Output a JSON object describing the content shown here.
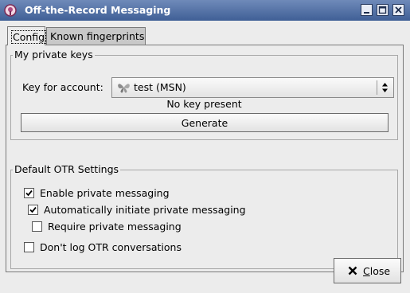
{
  "window": {
    "title": "Off-the-Record Messaging"
  },
  "tabs": [
    {
      "label": "Config",
      "active": true
    },
    {
      "label": "Known fingerprints",
      "active": false
    }
  ],
  "private_keys": {
    "frame_label": "My private keys",
    "account_label": "Key for account:",
    "account_value": "test (MSN)",
    "account_icon": "msn-butterfly-icon",
    "status": "No key present",
    "generate_label": "Generate"
  },
  "otr_settings": {
    "frame_label": "Default OTR Settings",
    "enable": {
      "label": "Enable private messaging",
      "checked": true
    },
    "auto_initiate": {
      "label": "Automatically initiate private messaging",
      "checked": true
    },
    "require": {
      "label": "Require private messaging",
      "checked": false
    },
    "dont_log": {
      "label": "Don't log OTR conversations",
      "checked": false
    }
  },
  "footer": {
    "close_label": "Close",
    "close_mnemonic": "C",
    "close_rest": "lose"
  }
}
